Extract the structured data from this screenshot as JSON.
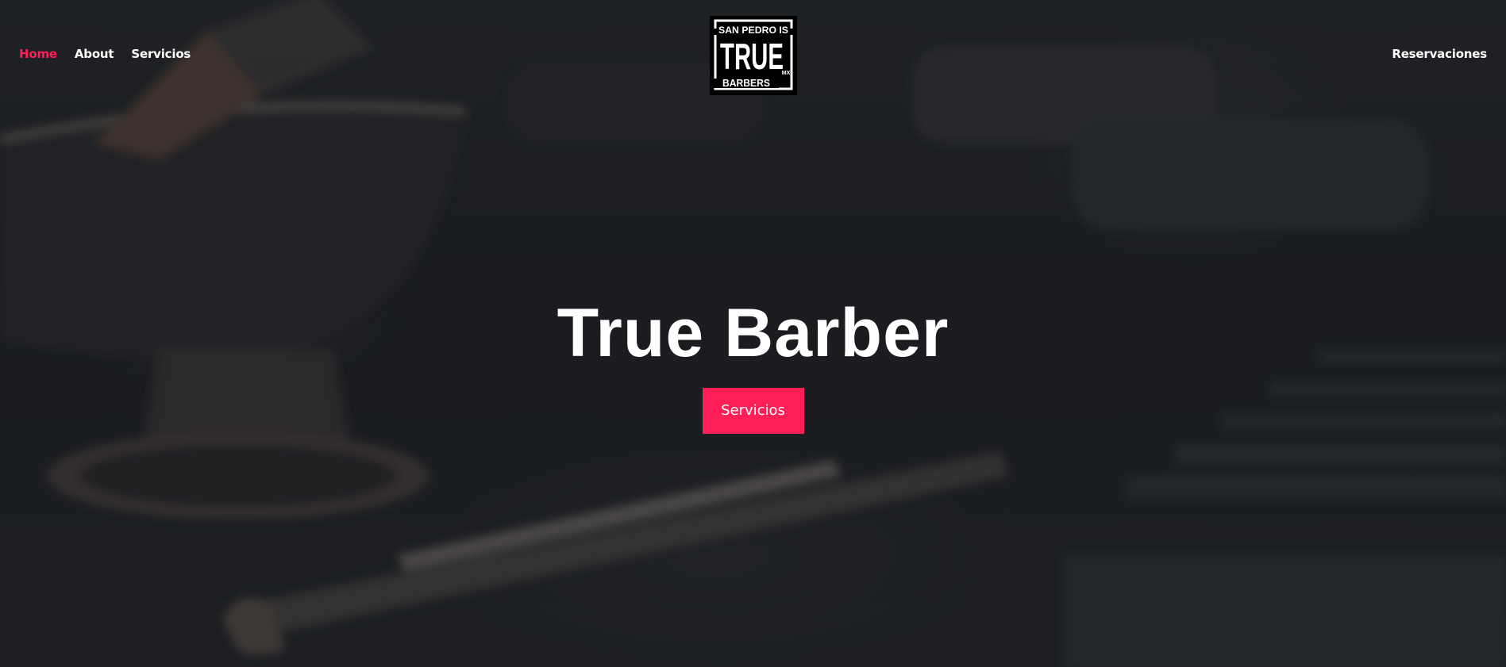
{
  "nav": {
    "links": [
      {
        "label": "Home",
        "active": true
      },
      {
        "label": "About",
        "active": false
      },
      {
        "label": "Servicios",
        "active": false
      }
    ],
    "reservations_label": "Reservaciones"
  },
  "logo": {
    "line1": "SAN PEDRO IS",
    "line2": "TRUE",
    "line3": "BARBERS",
    "tag": "MX"
  },
  "hero": {
    "title": "True Barber",
    "cta_label": "Servicios"
  },
  "colors": {
    "accent": "#ff1f57",
    "text": "#ffffff",
    "background": "#1f2125"
  }
}
